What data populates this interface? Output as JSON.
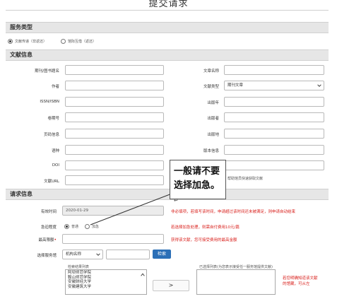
{
  "page_title": "提交请求",
  "service_section": {
    "title": "服务类型",
    "options": [
      {
        "label": "文献传递（非返还）",
        "selected": true
      },
      {
        "label": "馆际互借（返还）",
        "selected": false
      }
    ]
  },
  "doc_section": {
    "title": "文献信息",
    "left_fields": [
      {
        "label": "期刊/图书题名",
        "value": ""
      },
      {
        "label": "作者",
        "value": ""
      },
      {
        "label": "ISSN/ISBN",
        "value": ""
      },
      {
        "label": "卷期号",
        "value": ""
      },
      {
        "label": "页码信息",
        "value": ""
      },
      {
        "label": "语种",
        "value": ""
      },
      {
        "label": "DOI",
        "value": ""
      },
      {
        "label": "文献URL",
        "value": ""
      }
    ],
    "right_fields": [
      {
        "label": "文章名称",
        "value": ""
      },
      {
        "label": "文献类型",
        "value": "期刊文章",
        "type": "select"
      },
      {
        "label": "出版年",
        "value": ""
      },
      {
        "label": "出版者",
        "value": ""
      },
      {
        "label": "出版地",
        "value": ""
      },
      {
        "label": "版本信息",
        "value": ""
      },
      {
        "label": "",
        "value": ""
      }
    ],
    "url_hint": "帮助馆员快速获取文献"
  },
  "request_section": {
    "title": "请求信息",
    "valid_time_label": "有效时间",
    "valid_time_value": "2020-01-29",
    "valid_time_note": "非必填项，若填写该时间，申请超过该时间还未被满足，则申请自动结束",
    "urgency_label": "急迫程度",
    "urgency_options": [
      {
        "label": "普通",
        "selected": true
      },
      {
        "label": "加急",
        "selected": false
      }
    ],
    "urgency_note": "若选择加急处理，则需自付费用10元/篇",
    "max_cost_label": "最高限额",
    "max_cost_required": "•",
    "max_cost_note": "获得该文献，您可接受费用的最高金额",
    "service_lib_label": "选择服务馆",
    "service_lib_select": "机构名称",
    "search_button": "检索",
    "result_list_title": "检索结果列表",
    "result_list": [
      "阿坝师范学院",
      "鞍山师范学院",
      "安徽财经大学",
      "安徽建筑大学"
    ],
    "move_button": ">",
    "selected_list_title": "已选择列表(为您表示接受任一服务馆提供文献)",
    "selected_note": "若您明确知道该文献的馆藏，可从左"
  },
  "callout": {
    "text": "一般请不要选择加急。",
    "mark": "↵"
  }
}
